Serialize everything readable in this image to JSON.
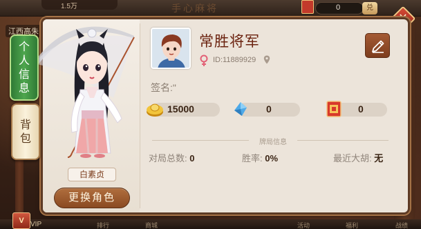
{
  "background": {
    "coin_amount": "1.5万",
    "title_faint": "手心麻将",
    "score_value": "0",
    "score_button": "兑",
    "region_label": "江西高朱",
    "vip_label": "V",
    "vip_text": "VIP",
    "bottom_labels": [
      "排行",
      "商城",
      "活动",
      "福利",
      "战绩"
    ]
  },
  "tabs": [
    {
      "label_lines": [
        "个",
        "人",
        "信",
        "息"
      ],
      "active": true
    },
    {
      "label_lines": [
        "背",
        "包"
      ],
      "active": false
    }
  ],
  "character": {
    "name": "白素贞",
    "change_button": "更换角色"
  },
  "player": {
    "name": "常胜将军",
    "id": "ID:11889929",
    "signature": "签名:\"",
    "gender_icon": "female-icon",
    "location_icon": "location-pin-icon",
    "edit_icon": "pencil-icon"
  },
  "currencies": [
    {
      "icon": "gold-ingot-icon",
      "value": "15000"
    },
    {
      "icon": "diamond-icon",
      "value": "0"
    },
    {
      "icon": "red-card-icon",
      "value": "0"
    }
  ],
  "stats_section": {
    "title": "牌局信息",
    "total_games_label": "对局总数:",
    "total_games_value": "0",
    "win_rate_label": "胜率:",
    "win_rate_value": "0%",
    "recent_hu_label": "最近大胡:",
    "recent_hu_value": "无"
  },
  "colors": {
    "accent_green": "#3e9541",
    "panel_bg": "#ece4da",
    "brown_button": "#9a5a30",
    "name_color": "#6b2310"
  }
}
